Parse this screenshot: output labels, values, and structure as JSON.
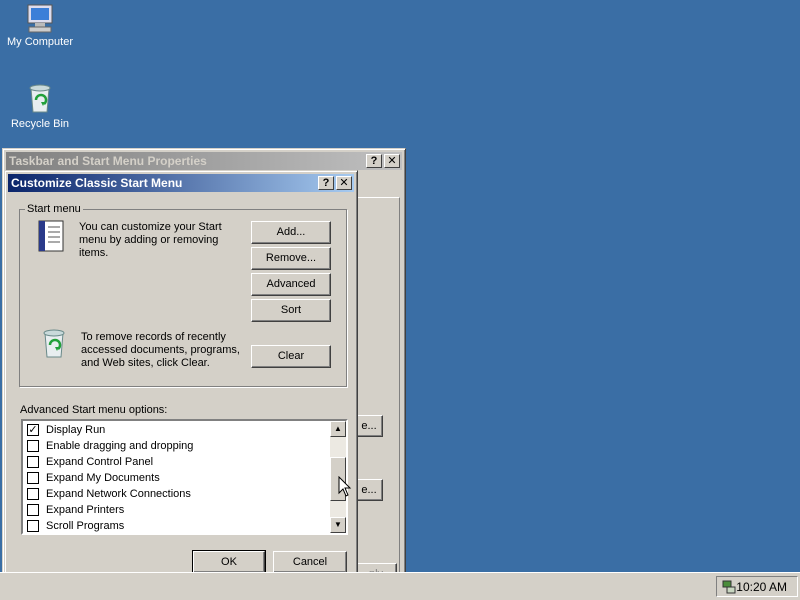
{
  "desktop": {
    "icons": [
      {
        "label": "My Computer",
        "icon": "my-computer-icon"
      },
      {
        "label": "Recycle Bin",
        "icon": "recycle-bin-icon"
      }
    ]
  },
  "bg_window": {
    "title": "Taskbar and Start Menu Properties",
    "partial_labels": [
      "e...",
      "e...",
      "ply"
    ]
  },
  "dialog": {
    "title": "Customize Classic Start Menu",
    "start_menu_group": {
      "legend": "Start menu",
      "description": "You can customize your Start menu by adding or removing items.",
      "clear_description": "To remove records of recently accessed documents, programs, and Web sites, click Clear.",
      "buttons": {
        "add": "Add...",
        "remove": "Remove...",
        "advanced": "Advanced",
        "sort": "Sort",
        "clear": "Clear"
      }
    },
    "advanced_options_label": "Advanced Start menu options:",
    "options": [
      {
        "label": "Display Run",
        "checked": true
      },
      {
        "label": "Enable dragging and dropping",
        "checked": false
      },
      {
        "label": "Expand Control Panel",
        "checked": false
      },
      {
        "label": "Expand My Documents",
        "checked": false
      },
      {
        "label": "Expand Network Connections",
        "checked": false
      },
      {
        "label": "Expand Printers",
        "checked": false
      },
      {
        "label": "Scroll Programs",
        "checked": false
      }
    ],
    "ok_label": "OK",
    "cancel_label": "Cancel"
  },
  "taskbar": {
    "clock": "10:20 AM"
  },
  "colors": {
    "desktop": "#3a6ea5",
    "title_active": "#0a246a",
    "face": "#d4d0c8"
  }
}
